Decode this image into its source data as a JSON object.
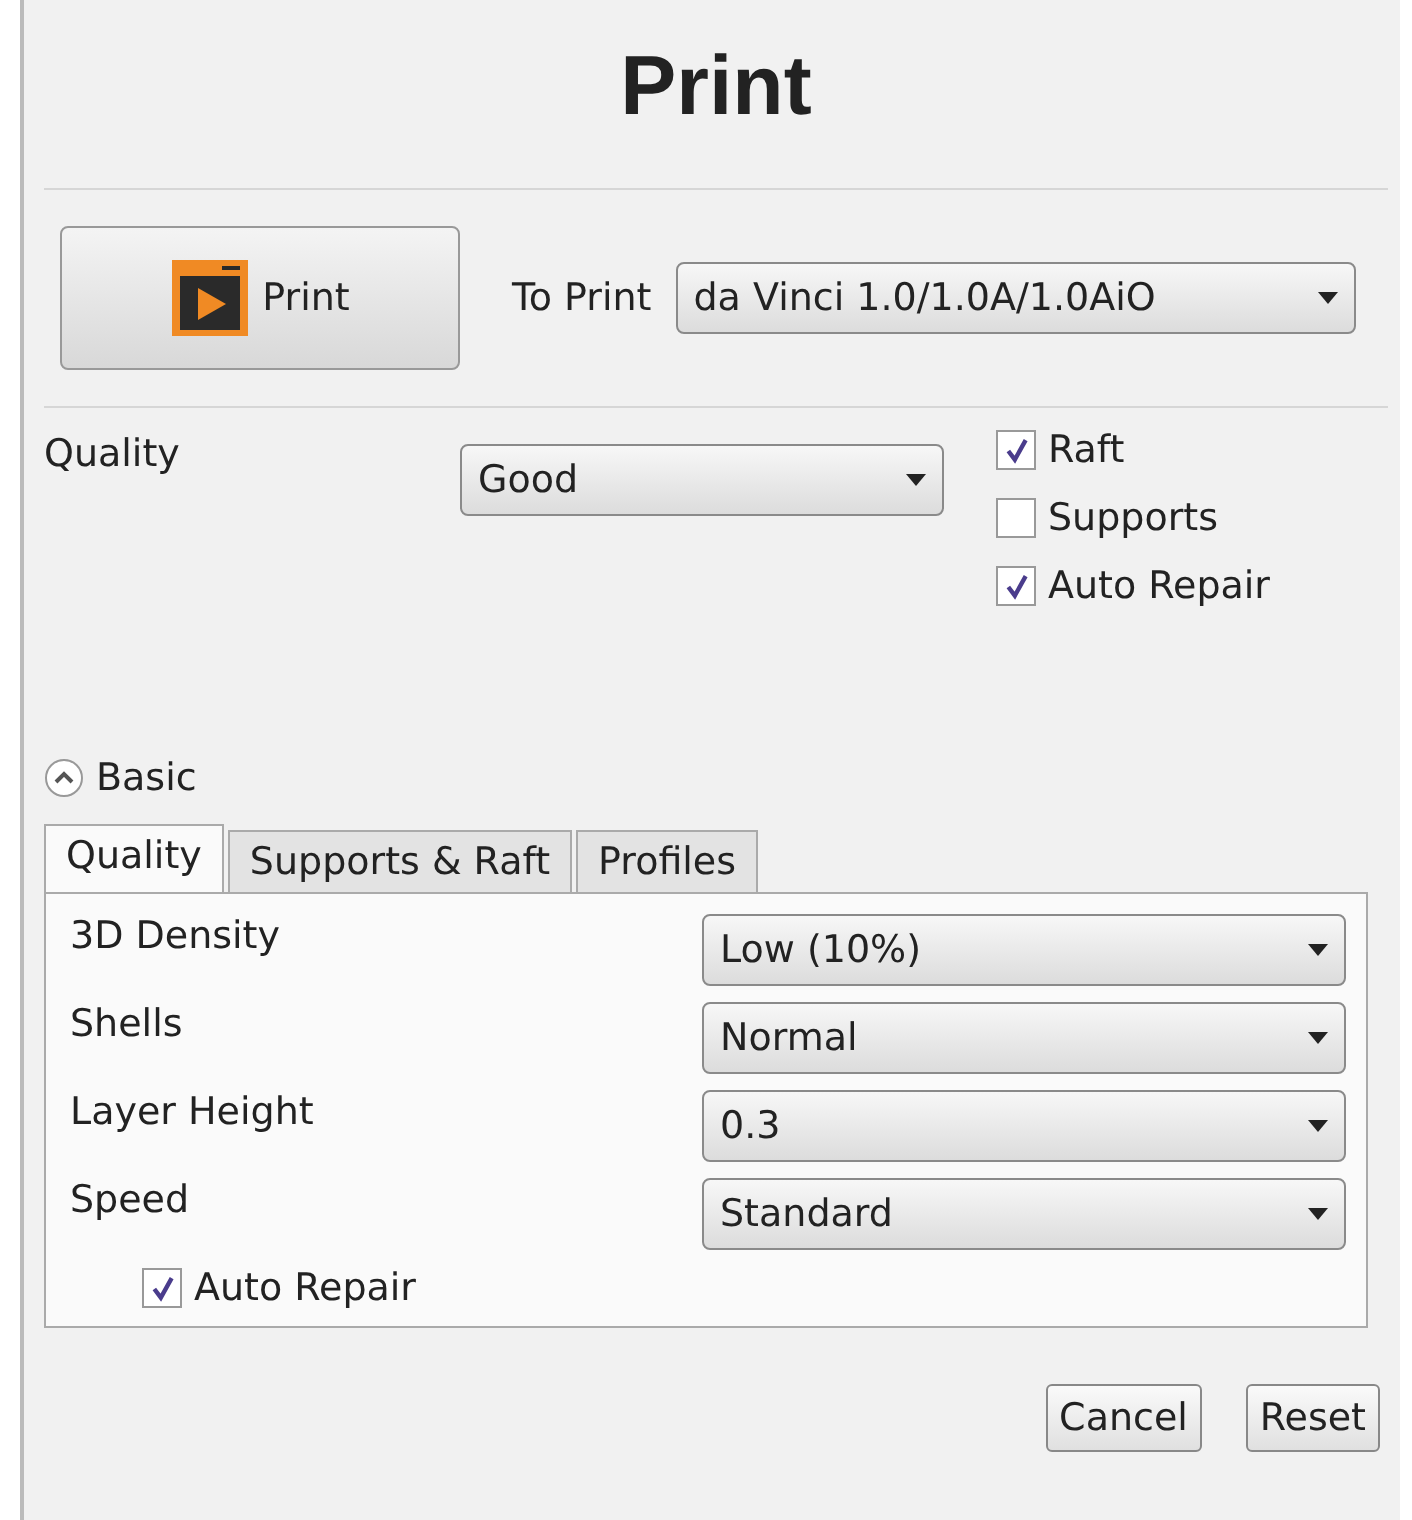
{
  "title": "Print",
  "print_button": {
    "label": "Print"
  },
  "target": {
    "label": "To Print",
    "value": "da Vinci 1.0/1.0A/1.0AiO"
  },
  "quality": {
    "label": "Quality",
    "value": "Good"
  },
  "options": [
    {
      "label": "Raft",
      "checked": true
    },
    {
      "label": "Supports",
      "checked": false
    },
    {
      "label": "Auto Repair",
      "checked": true
    }
  ],
  "section": {
    "label": "Basic",
    "expanded": true
  },
  "tabs": [
    {
      "label": "Quality",
      "selected": true
    },
    {
      "label": "Supports & Raft",
      "selected": false
    },
    {
      "label": "Profiles",
      "selected": false
    }
  ],
  "settings": [
    {
      "label": "3D Density",
      "value": "Low (10%)"
    },
    {
      "label": "Shells",
      "value": "Normal"
    },
    {
      "label": "Layer Height",
      "value": "0.3"
    },
    {
      "label": "Speed",
      "value": "Standard"
    }
  ],
  "auto_repair": {
    "label": "Auto Repair",
    "checked": true
  },
  "buttons": [
    "Cancel",
    "Reset"
  ]
}
